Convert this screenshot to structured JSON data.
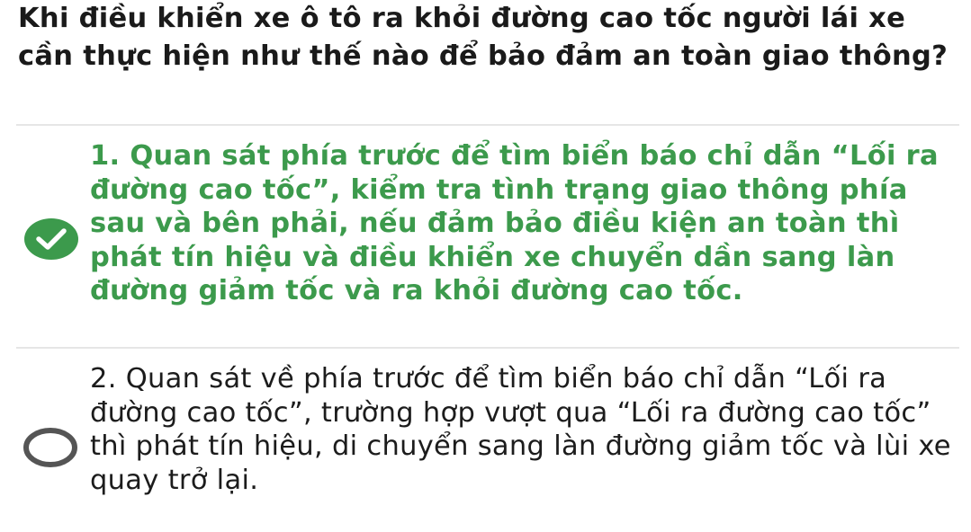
{
  "question": {
    "text": "Khi điều khiển xe ô tô ra khỏi đường cao tốc người lái xe cần thực hiện như thế nào để bảo đảm an toàn giao thông?"
  },
  "answers": [
    {
      "text": "1. Quan sát phía trước để tìm biển báo chỉ dẫn “Lối ra đường cao tốc”, kiểm tra tình trạng giao thông phía sau và bên phải, nếu đảm bảo điều kiện an toàn thì phát tín hiệu và điều khiển xe chuyển dần sang làn đường giảm tốc và ra khỏi đường cao tốc.",
      "selected": true,
      "icon": "check-circle-icon"
    },
    {
      "text": "2. Quan sát về phía trước để tìm biển báo chỉ dẫn “Lối ra đường cao tốc”, trường hợp vượt qua “Lối ra đường cao tốc” thì phát tín hiệu, di chuyển sang làn đường giảm tốc và lùi xe quay trở lại.",
      "selected": false,
      "icon": "radio-empty-icon"
    }
  ],
  "colors": {
    "correct": "#3c9a4c",
    "text": "#1c1c1c",
    "radio_border": "#555555",
    "divider": "#e6e6e6"
  }
}
